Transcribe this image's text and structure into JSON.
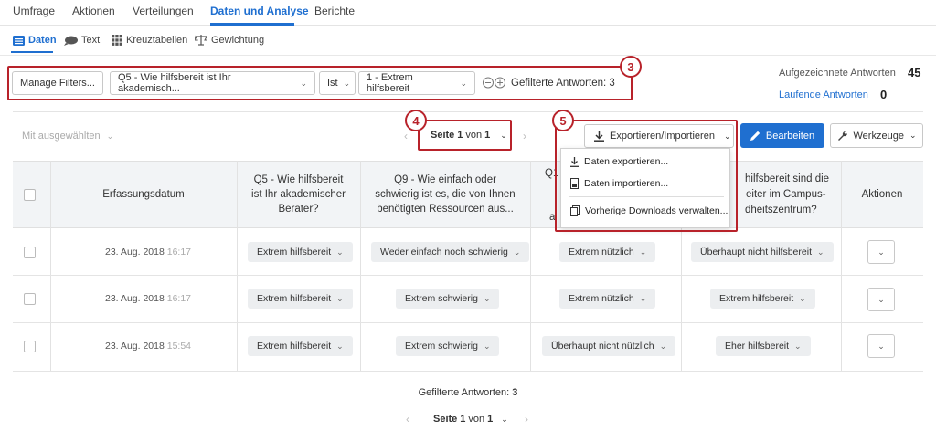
{
  "nav": {
    "tabs": [
      "Umfrage",
      "Aktionen",
      "Verteilungen",
      "Daten und Analyse",
      "Berichte"
    ],
    "active": "Daten und Analyse"
  },
  "subnav": {
    "items": [
      "Daten",
      "Text",
      "Kreuztabellen",
      "Gewichtung"
    ],
    "active": "Daten"
  },
  "filters": {
    "manage_label": "Manage Filters...",
    "question": "Q5 - Wie hilfsbereit ist Ihr akademisch...",
    "operator": "Ist",
    "value": "1 - Extrem hilfsbereit",
    "filtered_label": "Gefilterte Antworten: 3"
  },
  "stats": {
    "recorded_label": "Aufgezeichnete Antworten",
    "recorded_value": "45",
    "inprogress_label": "Laufende Antworten",
    "inprogress_value": "0"
  },
  "toolbar": {
    "with_selected": "Mit ausgewählten",
    "page_label": "Seite",
    "page_current": "1",
    "page_of": "von",
    "page_total": "1",
    "export_label": "Exportieren/Importieren",
    "edit_label": "Bearbeiten",
    "tools_label": "Werkzeuge"
  },
  "export_menu": {
    "items": [
      "Daten exportieren...",
      "Daten importieren...",
      "Vorherige Downloads verwalten..."
    ]
  },
  "annotations": [
    "3",
    "4",
    "5"
  ],
  "table": {
    "headers": [
      "Erfassungsdatum",
      "Q5 - Wie hilfsbereit ist Ihr akademischer Berater?",
      "Q9 - Wie einfach oder schwierig ist es, die von Ihnen benötigten Ressourcen aus...",
      "Q1",
      "a",
      "hilfsbereit sind die",
      "eiter im Campus-",
      "dheitszentrum?",
      "Aktionen"
    ],
    "rows": [
      {
        "date": "23. Aug. 2018",
        "time": "16:17",
        "q5": "Extrem hilfsbereit",
        "q9": "Weder einfach noch schwierig",
        "q1": "Extrem nützlich",
        "q_last": "Überhaupt nicht hilfsbereit"
      },
      {
        "date": "23. Aug. 2018",
        "time": "16:17",
        "q5": "Extrem hilfsbereit",
        "q9": "Extrem schwierig",
        "q1": "Extrem nützlich",
        "q_last": "Extrem hilfsbereit"
      },
      {
        "date": "23. Aug. 2018",
        "time": "15:54",
        "q5": "Extrem hilfsbereit",
        "q9": "Extrem schwierig",
        "q1": "Überhaupt nicht nützlich",
        "q_last": "Eher hilfsbereit"
      }
    ]
  },
  "footer": {
    "filtered_label": "Gefilterte Antworten:",
    "filtered_value": "3"
  },
  "colors": {
    "accent": "#1f6fd0",
    "annotation": "#b8222a"
  }
}
